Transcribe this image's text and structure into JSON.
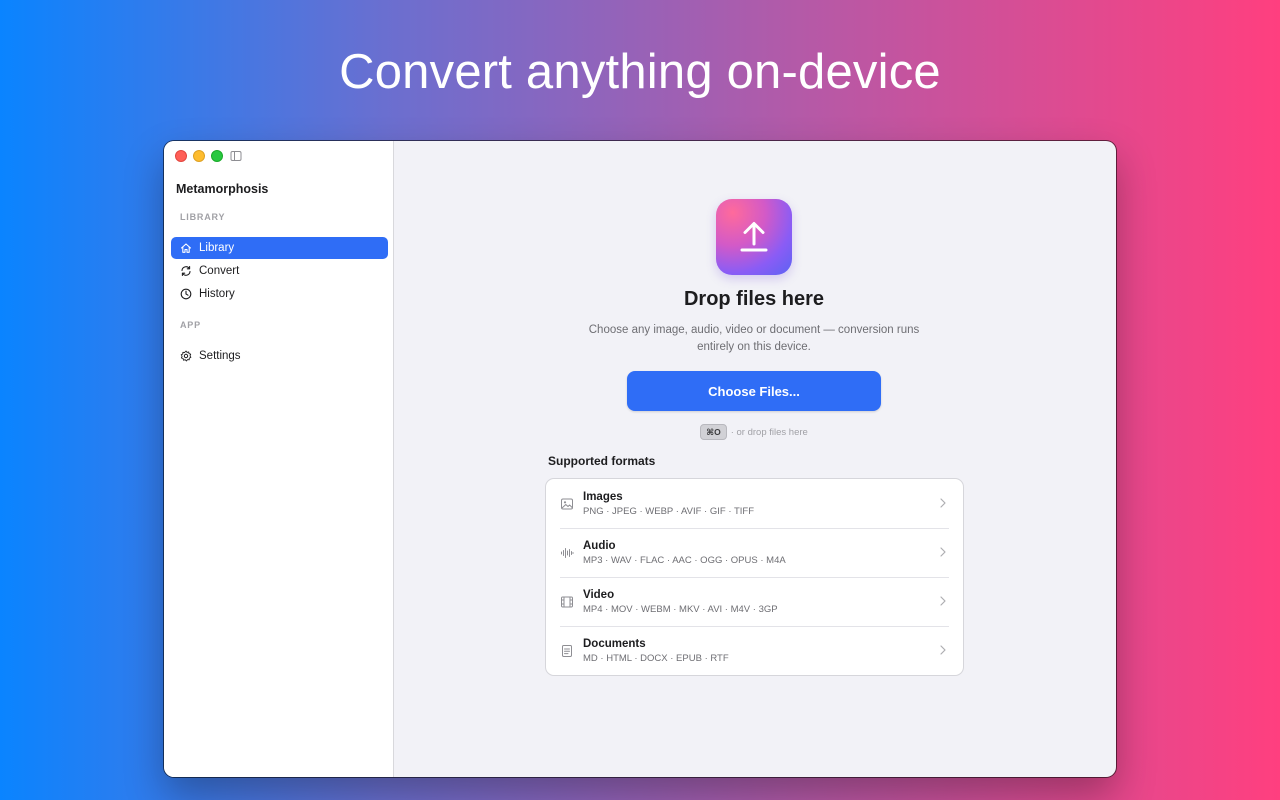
{
  "headline": "Convert anything on-device",
  "window": {
    "app_title": "Metamorphosis"
  },
  "sidebar": {
    "section_library": "LIBRARY",
    "section_app": "APP",
    "items": [
      {
        "label": "Library",
        "icon": "house-icon",
        "active": true
      },
      {
        "label": "Convert",
        "icon": "refresh-icon",
        "active": false
      },
      {
        "label": "History",
        "icon": "clock-icon",
        "active": false
      },
      {
        "label": "Settings",
        "icon": "gear-icon",
        "active": false
      }
    ]
  },
  "main": {
    "upload_icon": "upload-arrow-icon",
    "title": "Drop files here",
    "subtitle": "Choose any image, audio, video or document — conversion runs entirely on this device.",
    "choose_button": "Choose Files...",
    "shortcut_key": "⌘O",
    "shortcut_hint": "· or drop files here",
    "formats_heading": "Supported formats",
    "formats": [
      {
        "name": "Images",
        "list": "PNG · JPEG · WEBP · AVIF · GIF · TIFF",
        "icon": "photo-icon"
      },
      {
        "name": "Audio",
        "list": "MP3 · WAV · FLAC · AAC · OGG · OPUS · M4A",
        "icon": "waveform-icon"
      },
      {
        "name": "Video",
        "list": "MP4 · MOV · WEBM · MKV · AVI · M4V · 3GP",
        "icon": "film-icon"
      },
      {
        "name": "Documents",
        "list": "MD · HTML · DOCX · EPUB · RTF",
        "icon": "document-icon"
      }
    ]
  },
  "colors": {
    "accent": "#2f6df6",
    "background_left": "#0a84ff",
    "background_right": "#ff3f7f"
  }
}
